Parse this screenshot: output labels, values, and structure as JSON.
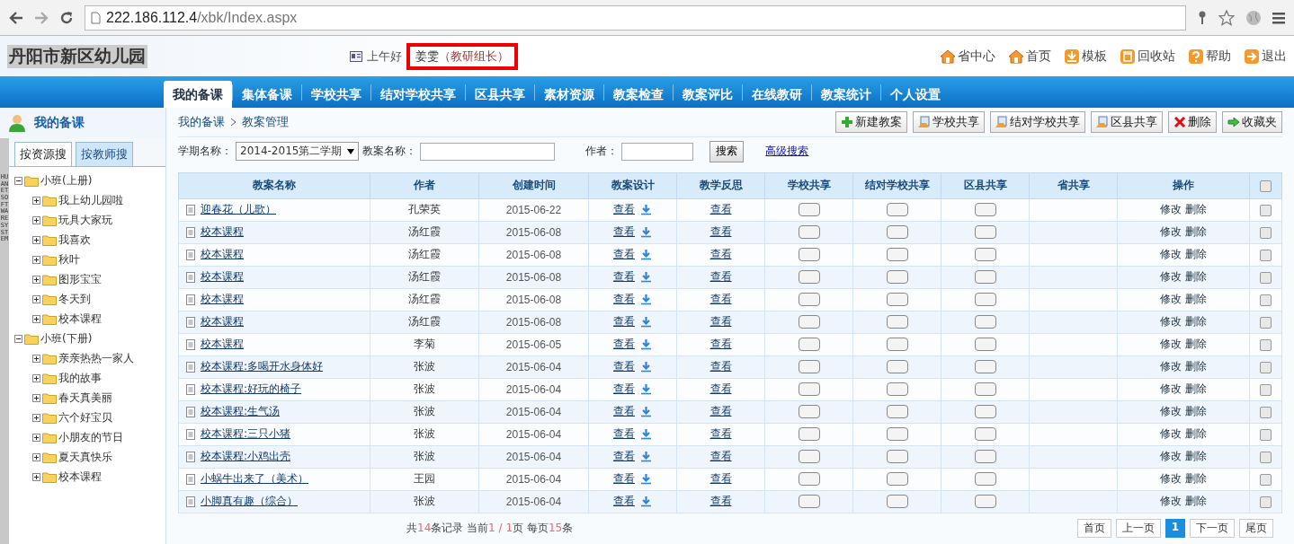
{
  "browser": {
    "url_host": "222.186.112.4",
    "url_path": "/xbk/Index.aspx"
  },
  "header": {
    "site_title": "丹阳市新区幼儿园",
    "greeting": "上午好",
    "user": "姜雯",
    "role": "（教研组长）",
    "links": [
      {
        "label": "省中心"
      },
      {
        "label": "首页"
      },
      {
        "label": "模板"
      },
      {
        "label": "回收站"
      },
      {
        "label": "帮助"
      },
      {
        "label": "退出"
      }
    ]
  },
  "nav": [
    {
      "label": "我的备课",
      "selected": true
    },
    {
      "label": "集体备课",
      "selected": false
    },
    {
      "label": "学校共享",
      "selected": false
    },
    {
      "label": "结对学校共享",
      "selected": false
    },
    {
      "label": "区县共享",
      "selected": false
    },
    {
      "label": "素材资源",
      "selected": false
    },
    {
      "label": "教案检查",
      "selected": false
    },
    {
      "label": "教案评比",
      "selected": false
    },
    {
      "label": "在线教研",
      "selected": false
    },
    {
      "label": "教案统计",
      "selected": false
    },
    {
      "label": "个人设置",
      "selected": false
    }
  ],
  "sidebar": {
    "title": "我的备课",
    "side_label": "HUANET SOFTWARE SYSTEM",
    "tabs": [
      {
        "label": "按资源搜",
        "selected": true
      },
      {
        "label": "按教师搜",
        "selected": false
      }
    ],
    "tree": [
      {
        "label": "小班(上册)",
        "expanded": true,
        "children": [
          {
            "label": "我上幼儿园啦",
            "expanded": false
          },
          {
            "label": "玩具大家玩",
            "expanded": false
          },
          {
            "label": "我喜欢",
            "expanded": false
          },
          {
            "label": "秋叶",
            "expanded": false
          },
          {
            "label": "图形宝宝",
            "expanded": false
          },
          {
            "label": "冬天到",
            "expanded": false
          },
          {
            "label": "校本课程",
            "expanded": false
          }
        ]
      },
      {
        "label": "小班(下册)",
        "expanded": true,
        "children": [
          {
            "label": "亲亲热热一家人",
            "expanded": false
          },
          {
            "label": "我的故事",
            "expanded": false
          },
          {
            "label": "春天真美丽",
            "expanded": false
          },
          {
            "label": "六个好宝贝",
            "expanded": false
          },
          {
            "label": "小朋友的节日",
            "expanded": false
          },
          {
            "label": "夏天真快乐",
            "expanded": false
          },
          {
            "label": "校本课程",
            "expanded": false
          }
        ]
      }
    ]
  },
  "breadcrumb": [
    "我的备课",
    "教案管理"
  ],
  "toolbar": [
    {
      "label": "新建教案"
    },
    {
      "label": "学校共享"
    },
    {
      "label": "结对学校共享"
    },
    {
      "label": "区县共享"
    },
    {
      "label": "删除"
    },
    {
      "label": "收藏夹"
    }
  ],
  "filter": {
    "term_label": "学期名称：",
    "term_value": "2014-2015第二学期",
    "name_label": "教案名称：",
    "author_label": "作者：",
    "search_button": "搜索",
    "advanced_link": "高级搜索"
  },
  "table": {
    "columns": [
      "教案名称",
      "作者",
      "创建时间",
      "教案设计",
      "教学反思",
      "学校共享",
      "结对学校共享",
      "区县共享",
      "省共享",
      "操作"
    ],
    "header_checked": false,
    "rows": [
      {
        "name": "迎春花（儿歌）",
        "author": "孔荣英",
        "created": "2015-06-22",
        "design": "查看",
        "reflection": "查看",
        "school_share_on": false,
        "paired_share_on": false,
        "county_share_on": false,
        "edit": "修改",
        "delete": "删除",
        "checked": false
      },
      {
        "name": "校本课程",
        "author": "汤红霞",
        "created": "2015-06-08",
        "design": "查看",
        "reflection": "查看",
        "school_share_on": false,
        "paired_share_on": false,
        "county_share_on": false,
        "edit": "修改",
        "delete": "删除",
        "checked": false
      },
      {
        "name": "校本课程",
        "author": "汤红霞",
        "created": "2015-06-08",
        "design": "查看",
        "reflection": "查看",
        "school_share_on": false,
        "paired_share_on": false,
        "county_share_on": false,
        "edit": "修改",
        "delete": "删除",
        "checked": false
      },
      {
        "name": "校本课程",
        "author": "汤红霞",
        "created": "2015-06-08",
        "design": "查看",
        "reflection": "查看",
        "school_share_on": false,
        "paired_share_on": false,
        "county_share_on": false,
        "edit": "修改",
        "delete": "删除",
        "checked": false
      },
      {
        "name": "校本课程",
        "author": "汤红霞",
        "created": "2015-06-08",
        "design": "查看",
        "reflection": "查看",
        "school_share_on": false,
        "paired_share_on": false,
        "county_share_on": false,
        "edit": "修改",
        "delete": "删除",
        "checked": false
      },
      {
        "name": "校本课程",
        "author": "汤红霞",
        "created": "2015-06-08",
        "design": "查看",
        "reflection": "查看",
        "school_share_on": false,
        "paired_share_on": false,
        "county_share_on": false,
        "edit": "修改",
        "delete": "删除",
        "checked": false
      },
      {
        "name": "校本课程",
        "author": "李菊",
        "created": "2015-06-05",
        "design": "查看",
        "reflection": "查看",
        "school_share_on": false,
        "paired_share_on": false,
        "county_share_on": false,
        "edit": "修改",
        "delete": "删除",
        "checked": false
      },
      {
        "name": "校本课程:多喝开水身体好",
        "author": "张波",
        "created": "2015-06-04",
        "design": "查看",
        "reflection": "查看",
        "school_share_on": false,
        "paired_share_on": false,
        "county_share_on": false,
        "edit": "修改",
        "delete": "删除",
        "checked": false
      },
      {
        "name": "校本课程:好玩的椅子",
        "author": "张波",
        "created": "2015-06-04",
        "design": "查看",
        "reflection": "查看",
        "school_share_on": false,
        "paired_share_on": false,
        "county_share_on": false,
        "edit": "修改",
        "delete": "删除",
        "checked": false
      },
      {
        "name": "校本课程:生气汤",
        "author": "张波",
        "created": "2015-06-04",
        "design": "查看",
        "reflection": "查看",
        "school_share_on": false,
        "paired_share_on": false,
        "county_share_on": false,
        "edit": "修改",
        "delete": "删除",
        "checked": false
      },
      {
        "name": "校本课程:三只小猪",
        "author": "张波",
        "created": "2015-06-04",
        "design": "查看",
        "reflection": "查看",
        "school_share_on": false,
        "paired_share_on": false,
        "county_share_on": false,
        "edit": "修改",
        "delete": "删除",
        "checked": false
      },
      {
        "name": "校本课程:小鸡出壳",
        "author": "张波",
        "created": "2015-06-04",
        "design": "查看",
        "reflection": "查看",
        "school_share_on": false,
        "paired_share_on": false,
        "county_share_on": false,
        "edit": "修改",
        "delete": "删除",
        "checked": false
      },
      {
        "name": "小蜗牛出来了（美术）",
        "author": "王园",
        "created": "2015-06-04",
        "design": "查看",
        "reflection": "查看",
        "school_share_on": false,
        "paired_share_on": false,
        "county_share_on": false,
        "edit": "修改",
        "delete": "删除",
        "checked": false
      },
      {
        "name": "小脚真有趣（综合）",
        "author": "张波",
        "created": "2015-06-04",
        "design": "查看",
        "reflection": "查看",
        "school_share_on": false,
        "paired_share_on": false,
        "county_share_on": false,
        "edit": "修改",
        "delete": "删除",
        "checked": false
      }
    ]
  },
  "pagination": {
    "summary": {
      "prefix": "共",
      "total": "14",
      "mid": "条记录 当前",
      "current": "1",
      "sep": " / ",
      "pages": "1",
      "mid2": "页 每页",
      "per_page": "15",
      "suffix": "条"
    },
    "buttons": [
      {
        "label": "首页",
        "selected": false
      },
      {
        "label": "上一页",
        "selected": false
      },
      {
        "label": "1",
        "selected": true
      },
      {
        "label": "下一页",
        "selected": false
      },
      {
        "label": "尾页",
        "selected": false
      }
    ]
  }
}
